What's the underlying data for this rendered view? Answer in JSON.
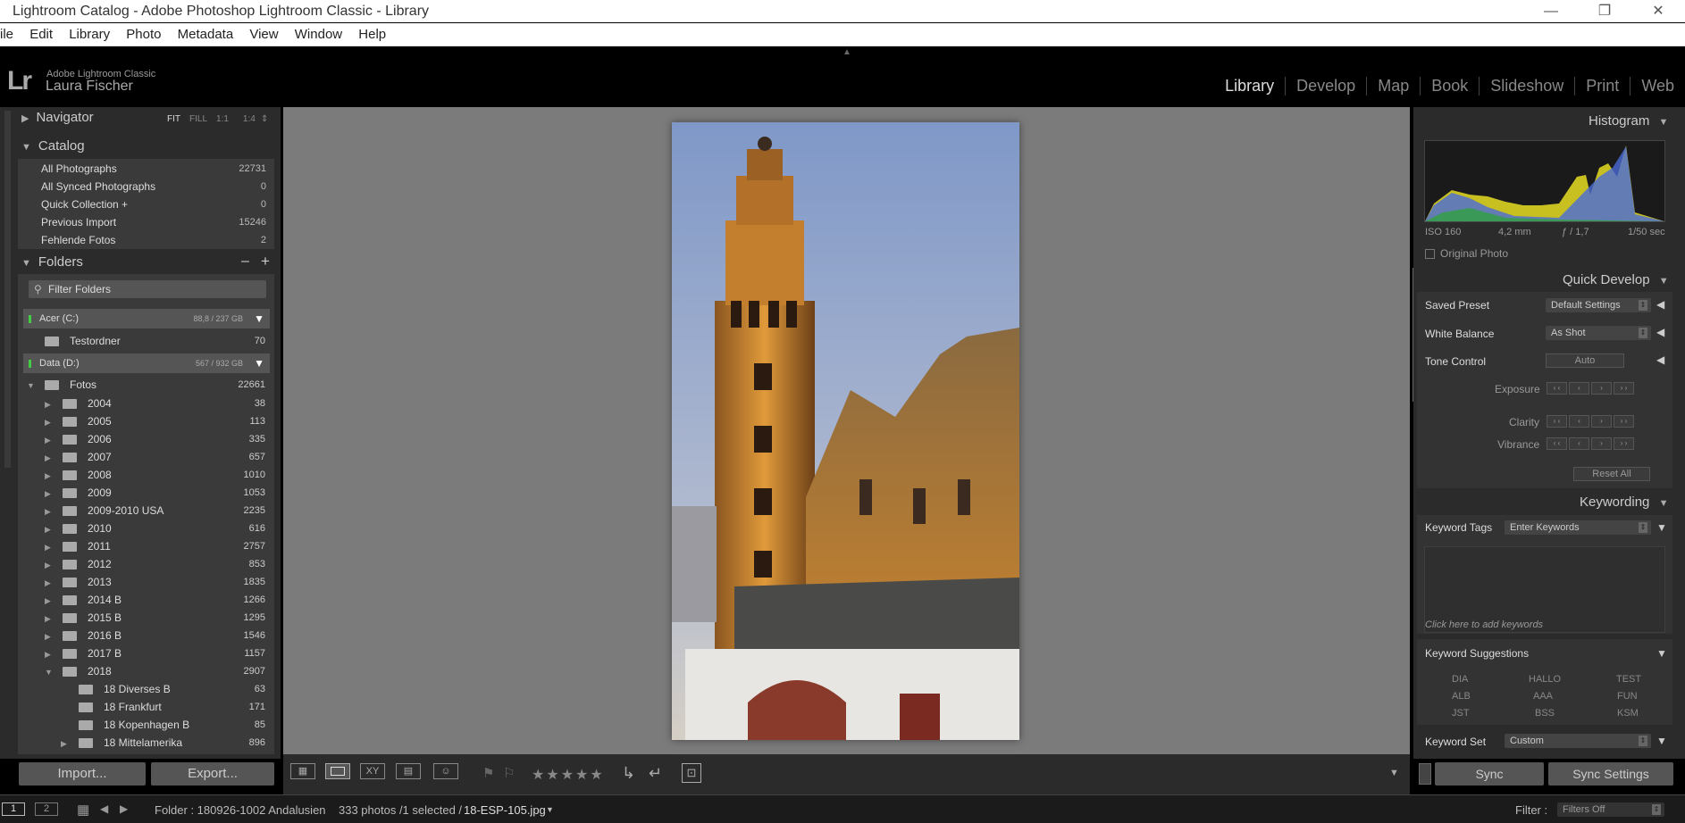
{
  "window": {
    "title": "Lightroom Catalog - Adobe Photoshop Lightroom Classic - Library",
    "controls": [
      "—",
      "❐",
      "✕"
    ]
  },
  "menu": [
    "ile",
    "Edit",
    "Library",
    "Photo",
    "Metadata",
    "View",
    "Window",
    "Help"
  ],
  "identity": {
    "logo": "Lr",
    "product": "Adobe Lightroom Classic",
    "user": "Laura Fischer"
  },
  "modules": [
    "Library",
    "Develop",
    "Map",
    "Book",
    "Slideshow",
    "Print",
    "Web"
  ],
  "navigator": {
    "title": "Navigator",
    "options": [
      "FIT",
      "FILL",
      "1:1",
      "1:4"
    ]
  },
  "catalog": {
    "title": "Catalog",
    "items": [
      {
        "label": "All Photographs",
        "count": "22731"
      },
      {
        "label": "All Synced Photographs",
        "count": "0"
      },
      {
        "label": "Quick Collection +",
        "count": "0"
      },
      {
        "label": "Previous Import",
        "count": "15246"
      },
      {
        "label": "Fehlende Fotos",
        "count": "2"
      }
    ]
  },
  "folders": {
    "title": "Folders",
    "minus": "–",
    "plus": "+",
    "filter_placeholder": "Filter Folders",
    "volumes": [
      {
        "label": "Acer (C:)",
        "capacity": "88,8 / 237 GB"
      },
      {
        "label": "Data (D:)",
        "capacity": "567 / 932 GB"
      }
    ],
    "testordner": {
      "label": "Testordner",
      "count": "70"
    },
    "fotos": {
      "label": "Fotos",
      "count": "22661"
    },
    "years": [
      {
        "label": "2004",
        "count": "38"
      },
      {
        "label": "2005",
        "count": "113"
      },
      {
        "label": "2006",
        "count": "335"
      },
      {
        "label": "2007",
        "count": "657"
      },
      {
        "label": "2008",
        "count": "1010"
      },
      {
        "label": "2009",
        "count": "1053"
      },
      {
        "label": "2009-2010 USA",
        "count": "2235"
      },
      {
        "label": "2010",
        "count": "616"
      },
      {
        "label": "2011",
        "count": "2757"
      },
      {
        "label": "2012",
        "count": "853"
      },
      {
        "label": "2013",
        "count": "1835"
      },
      {
        "label": "2014 B",
        "count": "1266"
      },
      {
        "label": "2015 B",
        "count": "1295"
      },
      {
        "label": "2016 B",
        "count": "1546"
      },
      {
        "label": "2017 B",
        "count": "1157"
      },
      {
        "label": "2018",
        "count": "2907"
      }
    ],
    "sub2018": [
      {
        "label": "18 Diverses B",
        "count": "63"
      },
      {
        "label": "18 Frankfurt",
        "count": "171"
      },
      {
        "label": "18 Kopenhagen B",
        "count": "85"
      },
      {
        "label": "18 Mittelamerika",
        "count": "896"
      }
    ]
  },
  "buttons": {
    "import": "Import...",
    "export": "Export..."
  },
  "histogram": {
    "title": "Histogram",
    "iso": "ISO 160",
    "focal": "4,2 mm",
    "aperture": "ƒ / 1,7",
    "shutter": "1/50 sec",
    "original_photo": "Original Photo"
  },
  "quick_develop": {
    "title": "Quick Develop",
    "saved_preset_label": "Saved Preset",
    "saved_preset_value": "Default Settings",
    "white_balance_label": "White Balance",
    "white_balance_value": "As Shot",
    "tone_control_label": "Tone Control",
    "auto": "Auto",
    "exposure": "Exposure",
    "clarity": "Clarity",
    "vibrance": "Vibrance",
    "reset_all": "Reset All",
    "steps": [
      "‹ ‹",
      "‹",
      "›",
      "› ›"
    ]
  },
  "keywording": {
    "title": "Keywording",
    "tags_label": "Keyword Tags",
    "tags_value": "Enter Keywords",
    "click_hint": "Click here to add keywords",
    "suggestions_title": "Keyword Suggestions",
    "suggestions": [
      "DIA",
      "HALLO",
      "TEST",
      "ALB",
      "AAA",
      "FUN",
      "JST",
      "BSS",
      "KSM"
    ],
    "set_label": "Keyword Set",
    "set_value": "Custom"
  },
  "sync": {
    "sync": "Sync",
    "sync_settings": "Sync Settings"
  },
  "filmstrip": {
    "page1": "1",
    "page2": "2",
    "folder": "Folder : 180926-1002 Andalusien",
    "photos": "333 photos /1 selected /",
    "filename": "18-ESP-105.jpg",
    "filter_label": "Filter :",
    "filter_value": "Filters Off"
  },
  "toolbar": {
    "stars": "★★★★★"
  }
}
